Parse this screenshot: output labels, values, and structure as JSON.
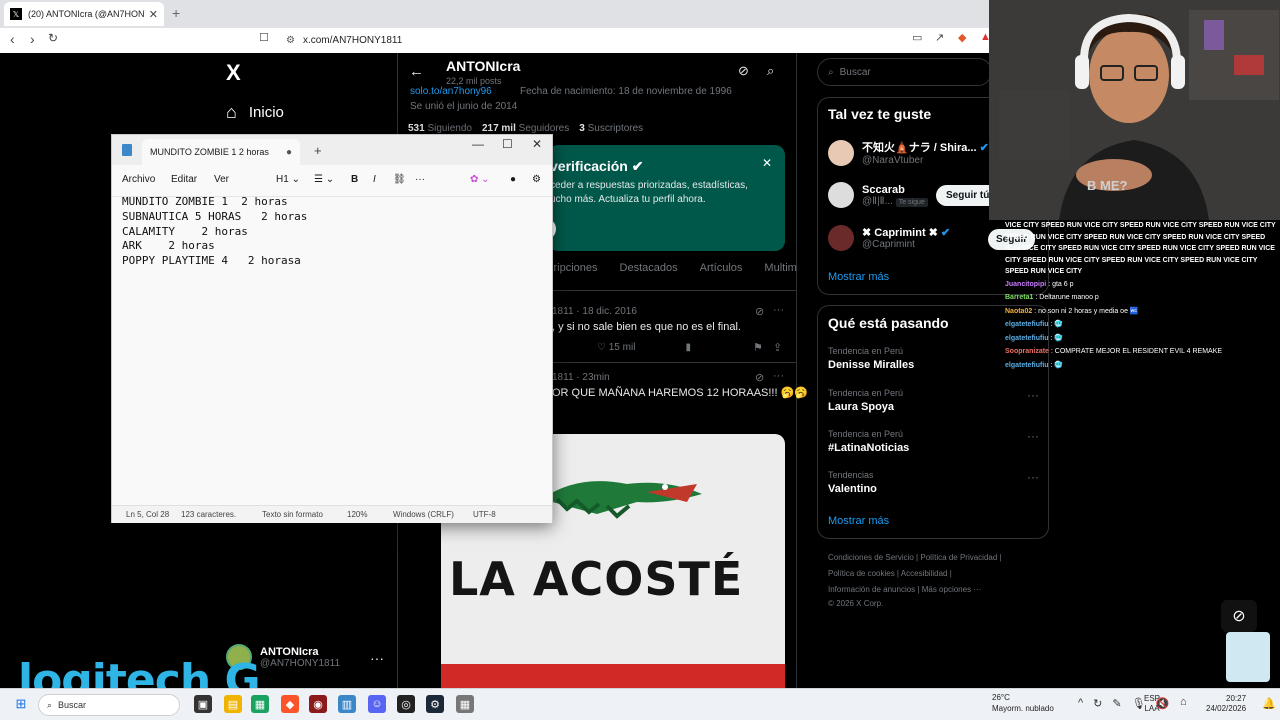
{
  "browser": {
    "tab_title": "(20) ANTONIcra (@AN7HONY18",
    "tab_icon": "x-logo",
    "address": "x.com/AN7HONY1811"
  },
  "x_left": {
    "logo": "X",
    "home_label": "Inicio",
    "account_name": "ANTONIcra",
    "account_handle": "@AN7HONY1811"
  },
  "profile": {
    "name": "ANTONIcra",
    "posts": "22,2 mil posts",
    "link": "solo.to/an7hony96",
    "birth": "Fecha de nacimiento: 18 de noviembre de 1996",
    "joined": "Se unió el junio de 2014",
    "following_count": "531",
    "following_label": "Siguiendo",
    "followers_count": "217 mil",
    "followers_label": "Seguidores",
    "subs_count": "3",
    "subs_label": "Suscriptores",
    "verify_title": "verificación",
    "verify_body": "ceder a respuestas priorizadas, estadísticas, ucho más. Actualiza tu perfil ahora.",
    "tabs": [
      "cripciones",
      "Destacados",
      "Artículos",
      "Multim"
    ]
  },
  "posts": [
    {
      "meta": "1811 · 18 dic. 2016",
      "text": ", y si no sale bien es que no es el final.",
      "likes": "15 mil"
    },
    {
      "meta": "1811 · 23min",
      "text": "OR QUE MAÑANA HAREMOS 12 HORAAS!!! 🥱🥱"
    }
  ],
  "post_image_text": "LA ACOSTÉ",
  "search": {
    "placeholder": "Buscar"
  },
  "who_to_follow": {
    "title": "Tal vez te guste",
    "accounts": [
      {
        "name": "不知火🛕ナラ / Shira...",
        "handle": "@NaraVtuber",
        "button": ""
      },
      {
        "name": "Sccarab",
        "handle": "@Ⅱ|Ⅱ...",
        "badge": "Te sigue",
        "button": "Seguir tú"
      },
      {
        "name": "✖ Caprimint ✖",
        "handle": "@Caprimint",
        "button": "Seguir"
      }
    ],
    "more": "Mostrar más"
  },
  "trends": {
    "title": "Qué está pasando",
    "items": [
      {
        "context": "Tendencia en Perú",
        "name": "Denisse Miralles"
      },
      {
        "context": "Tendencia en Perú",
        "name": "Laura Spoya"
      },
      {
        "context": "Tendencia en Perú",
        "name": "#LatinaNoticias"
      },
      {
        "context": "Tendencias",
        "name": "Valentino"
      }
    ],
    "more": "Mostrar más"
  },
  "footer": {
    "line1a": "Condiciones de Servicio",
    "line1b": "Política de Privacidad",
    "line2a": "Política de cookies",
    "line2b": "Accesibilidad",
    "line3a": "Información de anuncios",
    "line3b": "Más opciones ···",
    "copyright": "© 2026 X Corp."
  },
  "notepad": {
    "tab_title": "MUNDITO ZOMBIE 1  2 horas",
    "menu": [
      "Archivo",
      "Editar",
      "Ver"
    ],
    "heading_select": "H1",
    "content": "MUNDITO ZOMBIE 1  2 horas\nSUBNAUTICA 5 HORAS   2 horas\nCALAMITY    2 horas\nARK    2 horas\nPOPPY PLAYTIME 4   2 horasa",
    "status": {
      "position": "Ln 5, Col 28",
      "chars": "123 caracteres.",
      "format": "Texto sin formato",
      "zoom": "120%",
      "eol": "Windows (CRLF)",
      "encoding": "UTF-8"
    }
  },
  "stream": {
    "shirt_text": "B     ME?",
    "spam": "VICE CITY SPEED RUN VICE CITY SPEED RUN VICE CITY SPEED RUN VICE CITY SPEED RUN VICE CITY SPEED RUN VICE CITY SPEED RUN VICE CITY SPEED RUN VICE CITY SPEED RUN VICE CITY SPEED RUN VICE CITY SPEED RUN VICE CITY SPEED RUN VICE CITY SPEED RUN VICE CITY SPEED RUN VICE CITY SPEED RUN VICE CITY",
    "chat": [
      {
        "user": "Juancitopipi",
        "color": "#c77dff",
        "msg": ": gta 6 p"
      },
      {
        "user": "Barreta1",
        "color": "#7ddf64",
        "msg": ": Deltarune manoo p"
      },
      {
        "user": "Naota02",
        "color": "#f5b041",
        "msg": ": no son ni 2 horas y media oe 🚾"
      },
      {
        "user": "elgatetefiufiu",
        "color": "#5dade2",
        "msg": ": 🥶"
      },
      {
        "user": "elgatetefiufiu",
        "color": "#5dade2",
        "msg": ": 🥶"
      },
      {
        "user": "Soopranizate",
        "color": "#ec7063",
        "msg": ": COMPRATE MEJOR EL RESIDENT EVIL 4 REMAKE"
      },
      {
        "user": "elgatetefiufiu",
        "color": "#5dade2",
        "msg": ": 🥶"
      }
    ],
    "brand": "logitech G"
  },
  "taskbar": {
    "search": "Buscar",
    "weather_temp": "26°C",
    "weather_desc": "Mayorm. nublado",
    "lang1": "ESP",
    "lang2": "LAA",
    "time": "20:27",
    "date": "24/02/2026"
  },
  "colors": {
    "x_blue": "#1d9bf0",
    "verify_green": "#00584a",
    "logitech_blue": "#2fb4e6"
  }
}
